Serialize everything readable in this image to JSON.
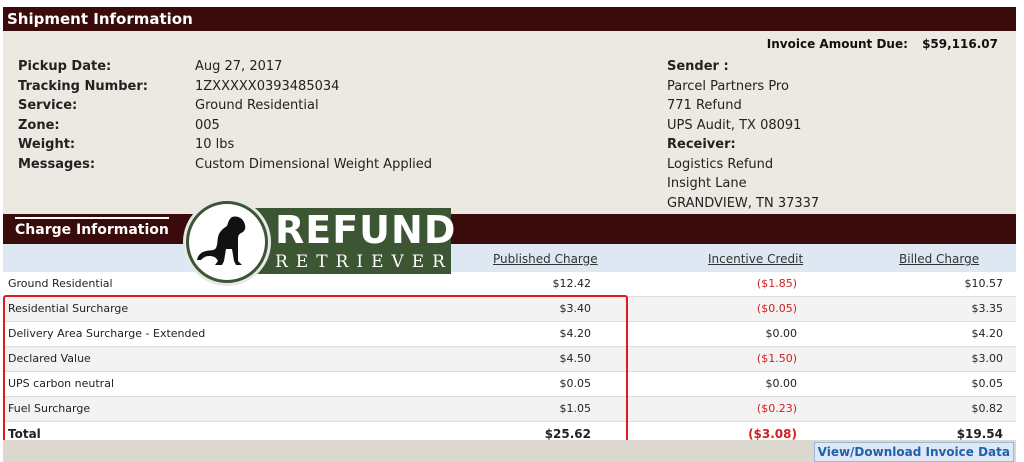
{
  "shipment": {
    "title": "Shipment Information",
    "invoice_label": "Invoice Amount Due:",
    "invoice_amount": "$59,116.07",
    "fields": [
      {
        "label": "Pickup Date:",
        "value": "Aug 27, 2017"
      },
      {
        "label": "Tracking Number:",
        "value": "1ZXXXXX0393485034"
      },
      {
        "label": "Service:",
        "value": "Ground Residential"
      },
      {
        "label": "Zone:",
        "value": "005"
      },
      {
        "label": "Weight:",
        "value": "10 lbs"
      },
      {
        "label": "Messages:",
        "value": "Custom Dimensional Weight Applied"
      }
    ],
    "sender_label": "Sender :",
    "sender_lines": [
      "Parcel Partners Pro",
      "771 Refund",
      "UPS Audit, TX 08091"
    ],
    "receiver_label": "Receiver:",
    "receiver_lines": [
      "Logistics Refund",
      "Insight Lane",
      "GRANDVIEW, TN 37337"
    ]
  },
  "charges": {
    "title": "Charge Information",
    "headers": [
      "Published Charge",
      "Incentive Credit",
      "Billed Charge"
    ],
    "rows": [
      {
        "name": "Ground Residential",
        "published": "$12.42",
        "incentive": "($1.85)",
        "billed": "$10.57"
      },
      {
        "name": "Residential Surcharge",
        "published": "$3.40",
        "incentive": "($0.05)",
        "billed": "$3.35"
      },
      {
        "name": "Delivery Area Surcharge - Extended",
        "published": "$4.20",
        "incentive": "$0.00",
        "billed": "$4.20"
      },
      {
        "name": "Declared Value",
        "published": "$4.50",
        "incentive": "($1.50)",
        "billed": "$3.00"
      },
      {
        "name": "UPS carbon neutral",
        "published": "$0.05",
        "incentive": "$0.00",
        "billed": "$0.05"
      },
      {
        "name": "Fuel Surcharge",
        "published": "$1.05",
        "incentive": "($0.23)",
        "billed": "$0.82"
      }
    ],
    "total": {
      "name": "Total",
      "published": "$25.62",
      "incentive": "($3.08)",
      "billed": "$19.54"
    },
    "negative_color": "#d02020"
  },
  "logo": {
    "word1": "REFUND",
    "word2": "RETRIEVER",
    "icon": "dog-silhouette-icon",
    "color": "#3c5533"
  },
  "actions": {
    "download_label": "View/Download Invoice Data"
  },
  "colors": {
    "header_bg": "#3a0b0b",
    "panel_bg": "#ece9e2",
    "highlight_border": "#e01b1b"
  }
}
